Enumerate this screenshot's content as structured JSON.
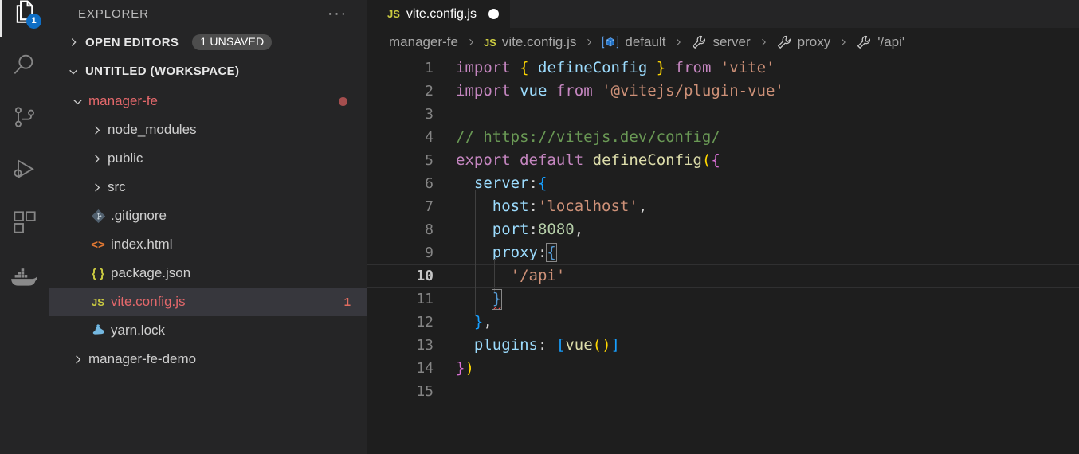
{
  "activity_bar": {
    "items": [
      {
        "name": "explorer",
        "icon": "files-icon",
        "active": true,
        "badge": "1"
      },
      {
        "name": "search",
        "icon": "search-icon",
        "active": false,
        "badge": ""
      },
      {
        "name": "source-control",
        "icon": "source-control-icon",
        "active": false,
        "badge": ""
      },
      {
        "name": "run-and-debug",
        "icon": "run-debug-icon",
        "active": false,
        "badge": ""
      },
      {
        "name": "extensions",
        "icon": "extensions-icon",
        "active": false,
        "badge": ""
      },
      {
        "name": "docker",
        "icon": "docker-whale-icon",
        "active": false,
        "badge": ""
      }
    ]
  },
  "sidebar": {
    "title": "EXPLORER",
    "more_actions": "···",
    "sections": [
      {
        "label": "OPEN EDITORS",
        "expanded": false,
        "badge": "1 UNSAVED"
      },
      {
        "label": "UNTITLED (WORKSPACE)",
        "expanded": true,
        "badge": ""
      }
    ],
    "tree": [
      {
        "label": "manager-fe",
        "depth": 0,
        "kind": "folder",
        "expanded": true,
        "icon": "chevron-down-icon",
        "error": true,
        "dot": true,
        "count": ""
      },
      {
        "label": "node_modules",
        "depth": 1,
        "kind": "folder",
        "expanded": false,
        "icon": "chevron-right-icon",
        "error": false,
        "dot": false,
        "count": ""
      },
      {
        "label": "public",
        "depth": 1,
        "kind": "folder",
        "expanded": false,
        "icon": "chevron-right-icon",
        "error": false,
        "dot": false,
        "count": ""
      },
      {
        "label": "src",
        "depth": 1,
        "kind": "folder",
        "expanded": false,
        "icon": "chevron-right-icon",
        "error": false,
        "dot": false,
        "count": ""
      },
      {
        "label": ".gitignore",
        "depth": 1,
        "kind": "file",
        "expanded": false,
        "icon": "git-icon",
        "error": false,
        "dot": false,
        "count": ""
      },
      {
        "label": "index.html",
        "depth": 1,
        "kind": "file",
        "expanded": false,
        "icon": "html-icon",
        "error": false,
        "dot": false,
        "count": ""
      },
      {
        "label": "package.json",
        "depth": 1,
        "kind": "file",
        "expanded": false,
        "icon": "json-icon",
        "error": false,
        "dot": false,
        "count": ""
      },
      {
        "label": "vite.config.js",
        "depth": 1,
        "kind": "file",
        "expanded": false,
        "icon": "js-icon",
        "error": true,
        "dot": false,
        "count": "1",
        "selected": true
      },
      {
        "label": "yarn.lock",
        "depth": 1,
        "kind": "file",
        "expanded": false,
        "icon": "yarn-icon",
        "error": false,
        "dot": false,
        "count": ""
      },
      {
        "label": "manager-fe-demo",
        "depth": 0,
        "kind": "folder",
        "expanded": false,
        "icon": "chevron-right-icon",
        "error": false,
        "dot": false,
        "count": ""
      }
    ]
  },
  "editor": {
    "tab": {
      "label": "vite.config.js",
      "icon": "js-icon",
      "icon_text": "JS",
      "dirty": true
    },
    "breadcrumbs": [
      {
        "label": "manager-fe",
        "icon": "none"
      },
      {
        "label": "vite.config.js",
        "icon": "js-icon",
        "icon_text": "JS"
      },
      {
        "label": "default",
        "icon": "symbol-module-icon"
      },
      {
        "label": "server",
        "icon": "symbol-property-icon"
      },
      {
        "label": "proxy",
        "icon": "symbol-property-icon"
      },
      {
        "label": "'/api'",
        "icon": "symbol-property-icon"
      }
    ],
    "breadcrumb_separator": "›",
    "current_line": 10,
    "lines": [
      {
        "n": "1",
        "text": "import { defineConfig } from 'vite'"
      },
      {
        "n": "2",
        "text": "import vue from '@vitejs/plugin-vue'"
      },
      {
        "n": "3",
        "text": ""
      },
      {
        "n": "4",
        "text": "// https://vitejs.dev/config/"
      },
      {
        "n": "5",
        "text": "export default defineConfig({"
      },
      {
        "n": "6",
        "text": "  server:{"
      },
      {
        "n": "7",
        "text": "    host:'localhost',"
      },
      {
        "n": "8",
        "text": "    port:8080,"
      },
      {
        "n": "9",
        "text": "    proxy:{"
      },
      {
        "n": "10",
        "text": "      '/api'"
      },
      {
        "n": "11",
        "text": "    }"
      },
      {
        "n": "12",
        "text": "  },"
      },
      {
        "n": "13",
        "text": "  plugins: [vue()]"
      },
      {
        "n": "14",
        "text": "})"
      },
      {
        "n": "15",
        "text": ""
      }
    ]
  },
  "colors": {
    "activitybar_bg": "#252526",
    "sidebar_bg": "#252526",
    "editor_bg": "#1e1e1e",
    "badge_blue": "#0e6ec5",
    "error_red": "#e4686b",
    "selection_bg": "#37373d",
    "keyword": "#c586c0",
    "variable": "#9cdcfe",
    "string": "#ce9178",
    "number": "#b5cea8",
    "function": "#dcdcaa",
    "comment": "#6a9955",
    "bracket_blue": "#569cd6",
    "squiggle": "#f14c4c"
  }
}
